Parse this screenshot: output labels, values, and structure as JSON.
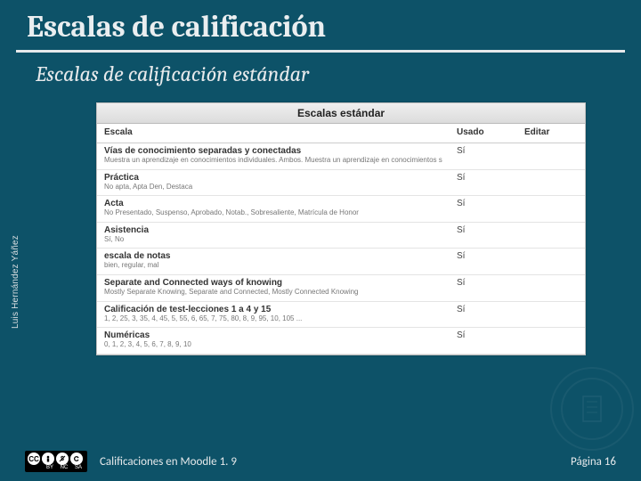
{
  "title": "Escalas de calificación",
  "subtitle": "Escalas de calificación estándar",
  "author": "Luis Hernández Yáñez",
  "panel": {
    "header": "Escalas estándar",
    "columns": {
      "scale": "Escala",
      "used": "Usado",
      "edit": "Editar"
    },
    "rows": [
      {
        "name": "Vías de conocimiento separadas y conectadas",
        "desc": "Muestra un aprendizaje en conocimientos individuales. Ambos. Muestra un aprendizaje en conocimientos solidarios",
        "used": "Sí"
      },
      {
        "name": "Práctica",
        "desc": "No apta, Apta Den, Destaca",
        "used": "Sí"
      },
      {
        "name": "Acta",
        "desc": "No Presentado, Suspenso, Aprobado, Notab., Sobresaliente, Matrícula de Honor",
        "used": "Sí"
      },
      {
        "name": "Asistencia",
        "desc": "Sí, No",
        "used": "Sí"
      },
      {
        "name": "escala de notas",
        "desc": "bien, regular, mal",
        "used": "Sí"
      },
      {
        "name": "Separate and Connected ways of knowing",
        "desc": "Mostly Separate Knowing, Separate and Connected, Mostly Connected Knowing",
        "used": "Sí"
      },
      {
        "name": "Calificación de test-lecciones 1 a 4 y 15",
        "desc": "1, 2, 25, 3, 35, 4, 45, 5, 55, 6, 65, 7, 75, 80, 8, 9, 95, 10, 105 ...",
        "used": "Sí"
      },
      {
        "name": "Numéricas",
        "desc": "0, 1, 2, 3, 4, 5, 6, 7, 8, 9, 10",
        "used": "Sí"
      }
    ]
  },
  "footer": {
    "course": "Calificaciones en Moodle 1. 9",
    "page": "Página 16"
  },
  "cc": {
    "by": "BY",
    "nc": "NC",
    "sa": "SA",
    "cc": "CC"
  }
}
